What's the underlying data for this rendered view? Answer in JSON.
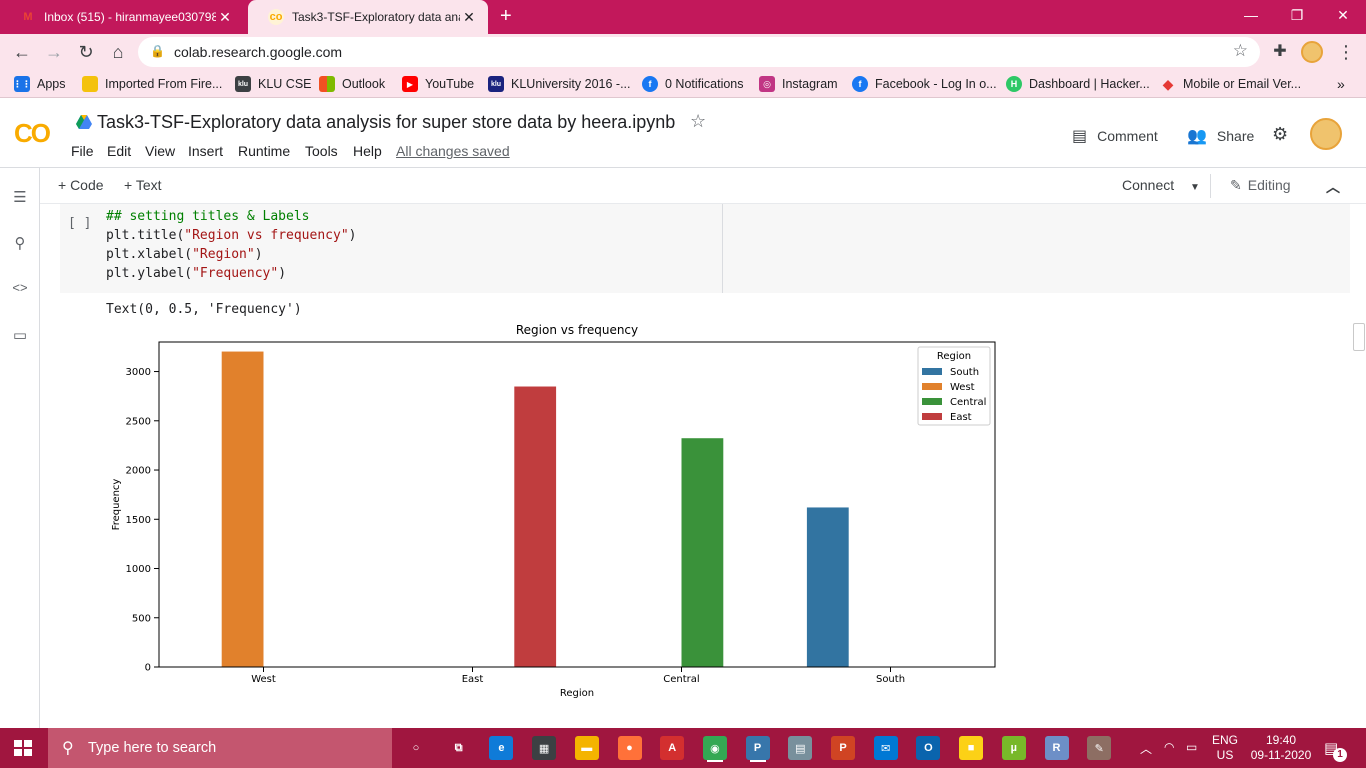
{
  "browser": {
    "tabs": [
      {
        "title": "Inbox (515) - hiranmayee030798",
        "active": false
      },
      {
        "title": "Task3-TSF-Exploratory data analy",
        "active": true
      }
    ],
    "new_tab": "+",
    "url": "colab.research.google.com",
    "window_controls": {
      "minimize": "—",
      "restore": "❐",
      "close": "✕"
    }
  },
  "bookmarks": [
    {
      "label": "Apps",
      "icon": "apps-grid-icon",
      "color": "#1a73e8"
    },
    {
      "label": "Imported From Fire...",
      "icon": "folder-icon",
      "color": "#f4c20d"
    },
    {
      "label": "KLU CSE",
      "icon": "klu-icon",
      "color": "#3c4043"
    },
    {
      "label": "Outlook",
      "icon": "outlook-icon",
      "color": "#f25022"
    },
    {
      "label": "YouTube",
      "icon": "youtube-icon",
      "color": "#ff0000"
    },
    {
      "label": "KLUniversity 2016 -...",
      "icon": "klu-2016-icon",
      "color": "#1a237e"
    },
    {
      "label": "0 Notifications",
      "icon": "facebook-icon",
      "color": "#1877f2"
    },
    {
      "label": "Instagram",
      "icon": "instagram-icon",
      "color": "#c13584"
    },
    {
      "label": "Facebook - Log In o...",
      "icon": "facebook-icon",
      "color": "#1877f2"
    },
    {
      "label": "Dashboard | Hacker...",
      "icon": "hackerrank-icon",
      "color": "#2ec866"
    },
    {
      "label": "Mobile or Email Ver...",
      "icon": "diamond-icon",
      "color": "#e53935"
    }
  ],
  "colab": {
    "logo": "CO",
    "notebook_title": "Task3-TSF-Exploratory data analysis for super store data by heera.ipynb",
    "menus": [
      "File",
      "Edit",
      "View",
      "Insert",
      "Runtime",
      "Tools",
      "Help"
    ],
    "save_status": "All changes saved",
    "comment_label": "Comment",
    "share_label": "Share"
  },
  "toolbar": {
    "add_code": "+ Code",
    "add_text": "+ Text",
    "connect": "Connect",
    "editing": "Editing"
  },
  "cell": {
    "run_indicator": "[ ]",
    "code_lines": [
      {
        "comment": "## setting titles & Labels"
      },
      {
        "pre": "plt.title(",
        "str": "\"Region vs frequency\"",
        "post": ")"
      },
      {
        "pre": "plt.xlabel(",
        "str": "\"Region\"",
        "post": ")"
      },
      {
        "pre": "plt.ylabel(",
        "str": "\"Frequency\"",
        "post": ")"
      }
    ],
    "output_text": "Text(0, 0.5, 'Frequency')"
  },
  "chart_data": {
    "type": "bar",
    "title": "Region vs frequency",
    "xlabel": "Region",
    "ylabel": "Frequency",
    "categories": [
      "West",
      "East",
      "Central",
      "South"
    ],
    "ylim": [
      0,
      3300
    ],
    "yticks": [
      0,
      500,
      1000,
      1500,
      2000,
      2500,
      3000
    ],
    "legend_title": "Region",
    "legend_position": "top-right",
    "grid": false,
    "series": [
      {
        "name": "South",
        "color": "#3274a1",
        "values": [
          0,
          0,
          0,
          1620
        ]
      },
      {
        "name": "West",
        "color": "#e1812c",
        "values": [
          3203,
          0,
          0,
          0
        ]
      },
      {
        "name": "Central",
        "color": "#3a923a",
        "values": [
          0,
          0,
          2323,
          0
        ]
      },
      {
        "name": "East",
        "color": "#c03d3e",
        "values": [
          0,
          2848,
          0,
          0
        ]
      }
    ]
  },
  "taskbar": {
    "search_placeholder": "Type here to search",
    "apps": [
      {
        "name": "cortana-icon",
        "color": "#a0163f",
        "glyph": "○"
      },
      {
        "name": "task-view-icon",
        "color": "#a0163f",
        "glyph": "⧉"
      },
      {
        "name": "edge-icon",
        "color": "#0f7bd8",
        "glyph": "e"
      },
      {
        "name": "store-icon",
        "color": "#3c4043",
        "glyph": "▦"
      },
      {
        "name": "file-explorer-icon",
        "color": "#f4b400",
        "glyph": "▬"
      },
      {
        "name": "firefox-icon",
        "color": "#ff7139",
        "glyph": "●"
      },
      {
        "name": "acrobat-icon",
        "color": "#d32f2f",
        "glyph": "A"
      },
      {
        "name": "chrome-icon",
        "color": "#34a853",
        "glyph": "◉"
      },
      {
        "name": "python-icon",
        "color": "#3776ab",
        "glyph": "P"
      },
      {
        "name": "printer-icon",
        "color": "#78909c",
        "glyph": "▤"
      },
      {
        "name": "powerpoint-icon",
        "color": "#d04423",
        "glyph": "P"
      },
      {
        "name": "mail-icon",
        "color": "#0078d4",
        "glyph": "✉"
      },
      {
        "name": "outlook-app-icon",
        "color": "#0a64ad",
        "glyph": "O"
      },
      {
        "name": "sticky-notes-icon",
        "color": "#fcd116",
        "glyph": "■"
      },
      {
        "name": "utorrent-icon",
        "color": "#78b829",
        "glyph": "µ"
      },
      {
        "name": "r-icon",
        "color": "#6d8fc7",
        "glyph": "R"
      },
      {
        "name": "paint-icon",
        "color": "#8d6e63",
        "glyph": "✎"
      }
    ],
    "language": "ENG",
    "region": "US",
    "time": "19:40",
    "date": "09-11-2020",
    "notification_count": "1"
  }
}
